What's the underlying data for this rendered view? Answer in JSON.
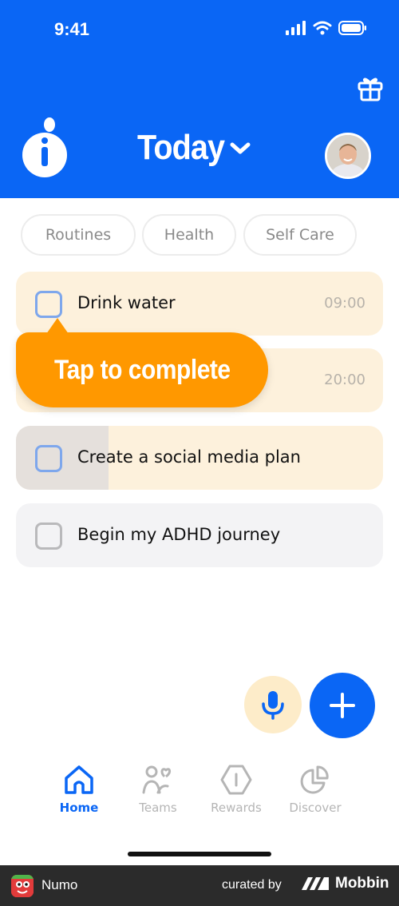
{
  "status_bar": {
    "time": "9:41",
    "icons": [
      "signal-icon",
      "wifi-icon",
      "battery-icon"
    ]
  },
  "header": {
    "title": "Today",
    "title_icon": "chevron-down-icon",
    "gift_icon": "gift-icon",
    "logo_icon": "app-logo-icon",
    "avatar_icon": "avatar",
    "background_color": "#0a66f5"
  },
  "filters": [
    {
      "label": "Routines"
    },
    {
      "label": "Health"
    },
    {
      "label": "Self Care"
    }
  ],
  "tasks": [
    {
      "label": "Drink water",
      "time": "09:00",
      "status": "pending",
      "color": "#fdf1dc"
    },
    {
      "label": "",
      "time": "20:00",
      "status": "pending",
      "color": "#fdf1dc"
    },
    {
      "label": "Create a social media plan",
      "time": "",
      "status": "pending",
      "color": "#fdf1dc"
    },
    {
      "label": "Begin my ADHD journey",
      "time": "",
      "status": "pending",
      "color": "#f3f3f5"
    }
  ],
  "tooltip": {
    "text": "Tap to complete",
    "color": "#ff9800"
  },
  "fabs": {
    "mic_icon": "microphone-icon",
    "add_icon": "plus-icon"
  },
  "bottom_nav": [
    {
      "label": "Home",
      "icon": "home-icon",
      "active": true
    },
    {
      "label": "Teams",
      "icon": "teams-icon",
      "active": false
    },
    {
      "label": "Rewards",
      "icon": "rewards-icon",
      "active": false
    },
    {
      "label": "Discover",
      "icon": "discover-icon",
      "active": false
    }
  ],
  "footer": {
    "app_name": "Numo",
    "curated_by": "curated by",
    "brand": "Mobbin"
  }
}
